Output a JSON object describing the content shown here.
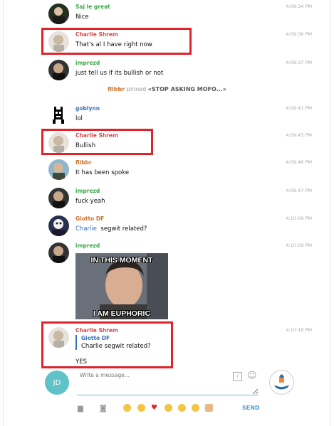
{
  "messages": [
    {
      "name": "Saj le great",
      "text": "Nice",
      "time": "4:09:34 PM",
      "color": "green"
    },
    {
      "name": "Charlie Shrem",
      "text": "That's al I have right now",
      "time": "4:09:36 PM",
      "color": "red"
    },
    {
      "name": "imprezd",
      "text": "just tell us if its bullish or not",
      "time": "4:09:37 PM",
      "color": "green"
    },
    {
      "name": "goblynn",
      "text": "lol",
      "time": "4:09:41 PM",
      "color": "blue"
    },
    {
      "name": "Charlie Shrem",
      "text": "Bullish",
      "time": "4:09:43 PM",
      "color": "red"
    },
    {
      "name": "flibbr",
      "text": "It has been spoke",
      "time": "4:09:46 PM",
      "color": "orange"
    },
    {
      "name": "imprezd",
      "text": "fuck yeah",
      "time": "4:09:47 PM",
      "color": "green"
    },
    {
      "name": "Giotto DF",
      "mention": "Charlie",
      "text": "segwit related?",
      "time": "4:10:09 PM",
      "color": "orange"
    },
    {
      "name": "imprezd",
      "time": "4:10:09 PM",
      "color": "green",
      "meme_top": "IN THIS MOMENT",
      "meme_bottom": "I AM EUPHORIC"
    },
    {
      "name": "Charlie Shrem",
      "time": "4:10:18 PM",
      "color": "red",
      "quote_name": "Giotto DF",
      "quote_text": "Charlie segwit related?",
      "text": "YES"
    }
  ],
  "pinned": {
    "who": "flibbr",
    "action": "pinned",
    "what": "«STOP ASKING MOFO...»"
  },
  "composer": {
    "avatar_initials": "JD",
    "placeholder": "Write a message...",
    "send": "SEND"
  }
}
